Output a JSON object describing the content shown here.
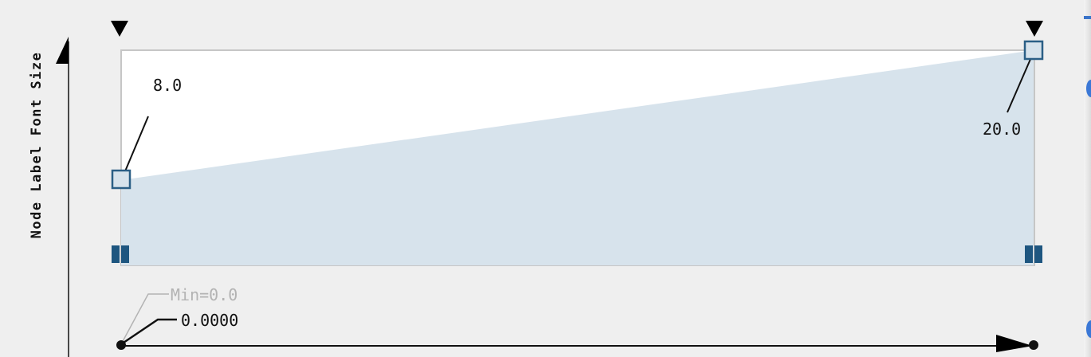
{
  "mapping_editor": {
    "y_axis_label": "Node Label Font Size",
    "handles": [
      {
        "label": "8.0",
        "value": 8.0
      },
      {
        "label": "20.0",
        "value": 20.0
      }
    ],
    "range_min_label": "Min=0.0",
    "current_value": "0.0000"
  },
  "colors": {
    "fill": "#d7e3ec",
    "handle": "#2b5f86",
    "marker": "#1e5680",
    "plot_border": "#c6c6c6"
  }
}
